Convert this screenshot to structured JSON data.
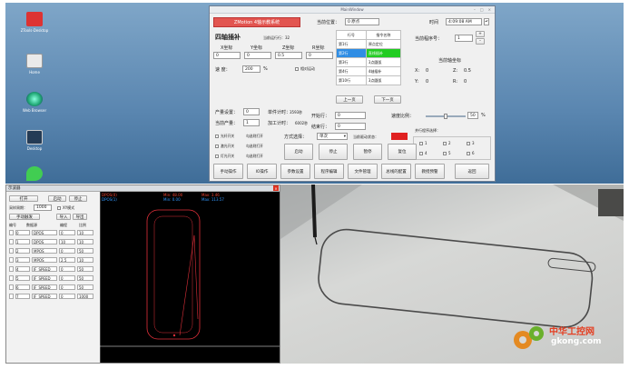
{
  "desktop": {
    "icons": [
      {
        "label": "ZTools-Desktop"
      },
      {
        "label": "Home"
      },
      {
        "label": "Web Browser"
      },
      {
        "label": "Desktop"
      },
      {
        "label": "QtCreator"
      }
    ]
  },
  "main_window": {
    "title": "MainWindow",
    "controls": [
      "–",
      "□",
      "×"
    ],
    "system_button": "ZMotion   4轴示教系统",
    "mode_title": "四轴插补",
    "current_line_label": "当前运行行：32",
    "axes_headers": [
      "X坐标",
      "Y坐标",
      "Z坐标",
      "R坐标"
    ],
    "axes_values": [
      "0",
      "0",
      "0.5",
      "0"
    ],
    "speed_label": "速  度：",
    "speed_value": "200",
    "speed_unit": "%",
    "relative_label": "相对运动",
    "position_label": "当前位置：",
    "position_value": "0 原点",
    "time_label": "时间",
    "time_value": "4:09:08 AM",
    "program_no_label": "当前程序号：",
    "program_no_value": "1",
    "program_table": {
      "headers": [
        "行号",
        "指令名称"
      ],
      "rows": [
        [
          "第1行",
          "原点定位"
        ],
        [
          "第2行",
          "直线插补"
        ],
        [
          "第3行",
          "3点圆弧"
        ],
        [
          "第4行",
          "4轴插补"
        ],
        [
          "第10行",
          "3点圆弧"
        ]
      ]
    },
    "prev_page": "上一页",
    "next_page": "下一页",
    "coords_title": "当前轴坐标",
    "coords": {
      "x_label": "X:",
      "x": "0",
      "z_label": "Z:",
      "z": "0.5",
      "y_label": "Y:",
      "y": "0",
      "r_label": "R:",
      "r": "0"
    },
    "output_set_label": "产量设置：",
    "output_set_value": "0",
    "current_output_label": "当前产量：",
    "current_output_value": "1",
    "unit_time_label": "单件计时：",
    "unit_time_value": "3593秒",
    "process_time_label": "加工计时：",
    "process_time_value": "6002秒",
    "start_line_label": "开始行：",
    "start_line_value": "0",
    "end_line_label": "结束行：",
    "end_line_value": "0",
    "ratio_label": "速度比例：",
    "ratio_value": "50",
    "ratio_unit": "%",
    "mode_select_label": "方式选择：",
    "mode_select_value": "单次",
    "hw_status_label": "当前驱动状态：",
    "parallel_label": "并行程序选择：",
    "parallel_options": [
      "1",
      "2",
      "3",
      "4",
      "5",
      "6"
    ],
    "io_checks": [
      {
        "a": "光纤开关",
        "b": "勾选则打开"
      },
      {
        "a": "激光开关",
        "b": "勾选则打开"
      },
      {
        "a": "灯光开关",
        "b": "勾选则打开"
      }
    ],
    "action_buttons": [
      "启动",
      "停止",
      "暂停",
      "复位"
    ],
    "bottom_nav": [
      "手动操作",
      "IO操作",
      "参数设置",
      "程序编辑",
      "文件管理",
      "总线的配置",
      "教授预警",
      "返回"
    ]
  },
  "left_app": {
    "title": "示波器",
    "btn_open": "打开",
    "btn_collect": "启动",
    "btn_stop": "停止",
    "sample_label": "采样周期：",
    "sample_value": "1000",
    "xy_mode_label": "XY模式",
    "manual_label": "手动触发",
    "import_label": "导入",
    "export_label": "导出",
    "col_headers": [
      "编号",
      "数据源",
      "编程",
      "比例"
    ],
    "rows": [
      {
        "id": "0",
        "src": "DPOS",
        "a": "0",
        "b": "10"
      },
      {
        "id": "1",
        "src": "DPOS",
        "a": "10",
        "b": "10"
      },
      {
        "id": "2",
        "src": "MPOS",
        "a": "0",
        "b": "50"
      },
      {
        "id": "3",
        "src": "MPOS",
        "a": "2.5",
        "b": "10"
      },
      {
        "id": "4",
        "src": "IF_SPEED",
        "a": "0",
        "b": "50"
      },
      {
        "id": "5",
        "src": "IF_SPEED",
        "a": "0",
        "b": "50"
      },
      {
        "id": "6",
        "src": "IF_SPEED",
        "a": "0",
        "b": "50"
      },
      {
        "id": "7",
        "src": "IF_SPEED",
        "a": "0",
        "b": "1000"
      }
    ],
    "scope_labels": {
      "ch1": "DPOS(0)",
      "ch2": "DPOS(1)",
      "min1": "Min: 48.00",
      "max1": "Max: 3.46",
      "min2": "Min: 0.00",
      "max2": "Max: 113.57"
    }
  },
  "watermark": {
    "cn": "中华工控网",
    "url": "gkong.com"
  }
}
